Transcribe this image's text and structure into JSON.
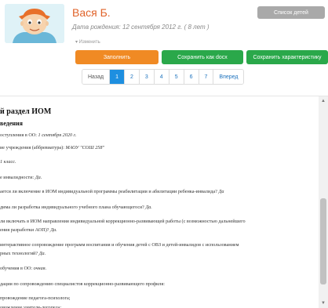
{
  "profile": {
    "name": "Вася Б.",
    "dob": "Дата рождения: 12 сентября 2012 г. ( 8 лет )",
    "change": "▾ Изменить"
  },
  "buttons": {
    "children_list": "Список детей",
    "fill": "Заполнить",
    "save_docx": "Сохранить как docx",
    "save_char": "Сохранить характеристику"
  },
  "pager": {
    "back": "Назад",
    "pages": [
      "1",
      "2",
      "3",
      "4",
      "5",
      "6",
      "7"
    ],
    "active": "1",
    "next": "Вперед"
  },
  "document": {
    "title": "й раздел ИОМ",
    "subtitle": "ведения",
    "lines": [
      {
        "text": "оступления в ОО: ",
        "value": "1 сентября 2020 г."
      },
      {
        "text": "ие учреждения (аббревиатура): ",
        "value": "МАОУ \"СОШ 258\""
      },
      {
        "text": "",
        "value": "1 класс."
      },
      {
        "text": "е инвалидности: ",
        "value": "Да."
      },
      {
        "text": "ается ли включение в ИОМ индивидуальной программы реабилитации и абилитации ребенка-инвалида? ",
        "value": "Да"
      },
      {
        "text": "дима ли разработка индивидуального учебного плана обучающегося? ",
        "value": "Да."
      },
      {
        "text": "ли включать в ИОМ направления индивидуальной коррекционно-развивающей работы (с возможностью дальнейшего",
        "value": ""
      },
      {
        "text": "ения разработки АОП)? ",
        "value": "Да."
      },
      {
        "text": "интерактивное сопровождение программ воспитания и обучения детей с ОВЗ и детей-инвалидов с использованием",
        "value": ""
      },
      {
        "text": "рных технологий? ",
        "value": "Да."
      },
      {
        "text": "обучения в ОО: ",
        "value": "очная."
      },
      {
        "text": "дации по сопровождению специалистов коррекционно-развивающего профиля:",
        "value": ""
      },
      {
        "text": "провождение педагога-психолога;",
        "value": ""
      },
      {
        "text": "овождение учителя-логопеда;",
        "value": ""
      }
    ]
  }
}
